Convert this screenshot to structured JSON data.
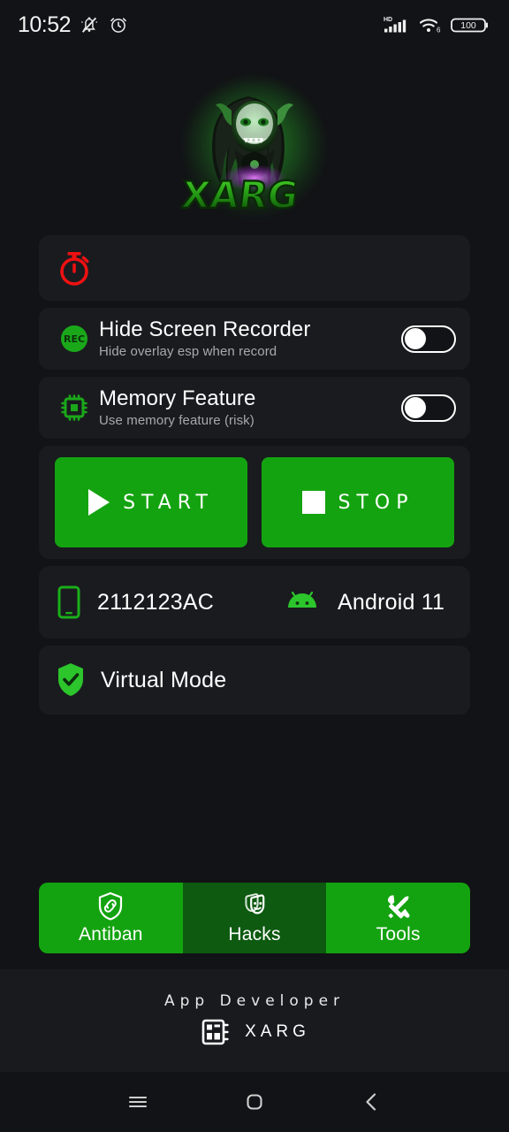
{
  "statusbar": {
    "time": "10:52",
    "icons_left": [
      "mute-bell-icon",
      "alarm-clock-icon"
    ],
    "network_label": "HD",
    "wifi_label": "6",
    "battery_level": "100"
  },
  "logo": {
    "name": "xarg-logo",
    "brand_text": "XARG",
    "glow_color": "#3ce63c"
  },
  "timer_card": {
    "icon": "stopwatch-icon",
    "icon_color": "#ee1111",
    "value": ""
  },
  "settings": [
    {
      "icon": "rec-icon",
      "icon_label": "REC",
      "title": "Hide Screen Recorder",
      "subtitle": "Hide overlay esp when record",
      "enabled": false
    },
    {
      "icon": "memory-chip-icon",
      "icon_label": "",
      "title": "Memory Feature",
      "subtitle": "Use memory feature (risk)",
      "enabled": false
    }
  ],
  "actions": {
    "start_label": "START",
    "start_icon": "play-icon",
    "stop_label": "STOP",
    "stop_icon": "stop-square-icon",
    "button_color": "#14a310"
  },
  "device": {
    "phone_icon": "smartphone-icon",
    "model": "2112123AC",
    "android_icon": "android-robot-icon",
    "os_version": "Android 11"
  },
  "virtual_mode": {
    "icon": "shield-check-icon",
    "label": "Virtual Mode"
  },
  "tabs": [
    {
      "label": "Antiban",
      "icon": "shield-link-icon",
      "active": true
    },
    {
      "label": "Hacks",
      "icon": "theater-masks-icon",
      "active": false
    },
    {
      "label": "Tools",
      "icon": "tools-icon",
      "active": true
    }
  ],
  "footer": {
    "title": "App Developer",
    "icon": "chip-board-icon",
    "developer": "XARG"
  },
  "navbar": {
    "recents_icon": "menu-icon",
    "home_icon": "home-square-icon",
    "back_icon": "chevron-left-icon"
  },
  "colors": {
    "background": "#121316",
    "card": "#1a1b1f",
    "accent_green": "#14a310",
    "accent_green_dark": "#0d5a10",
    "accent_red": "#ee1111",
    "text_primary": "#ffffff",
    "text_secondary": "#a7a9ad"
  }
}
